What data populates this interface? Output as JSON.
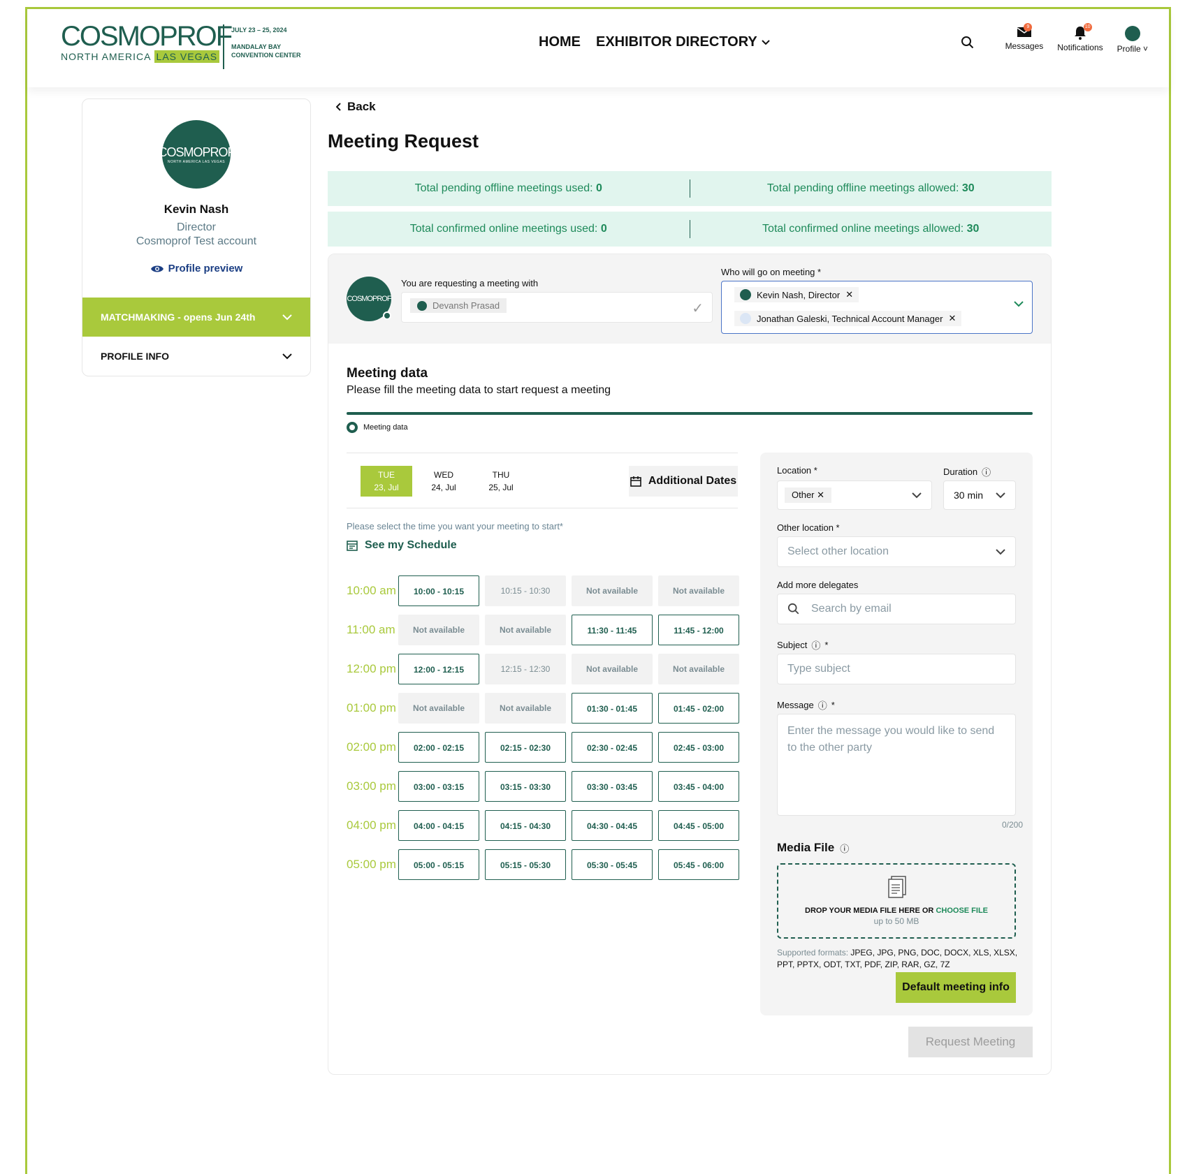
{
  "header": {
    "logo": {
      "main": "COSMOPROF",
      "sub_left": "NORTH AMERICA",
      "sub_right": "LAS VEGAS",
      "date": "JULY 23 – 25, 2024",
      "venue_1": "MANDALAY BAY",
      "venue_2": "CONVENTION CENTER"
    },
    "nav": [
      "HOME",
      "EXHIBITOR DIRECTORY"
    ],
    "icons": {
      "messages_label": "Messages",
      "messages_badge": "9",
      "notifications_label": "Notifications",
      "notifications_badge": "10",
      "profile_label": "Profile"
    }
  },
  "profile_card": {
    "avatar_text": "COSMOPROF",
    "avatar_sub": "NORTH AMERICA LAS VEGAS",
    "name": "Kevin Nash",
    "role": "Director",
    "company": "Cosmoprof Test account",
    "preview_label": "Profile preview",
    "matchmaking_label": "MATCHMAKING - opens Jun 24th",
    "profile_info_label": "PROFILE INFO"
  },
  "back_label": "Back",
  "page_title": "Meeting Request",
  "stats": {
    "pending_used_label": "Total pending offline meetings used:",
    "pending_used_value": "0",
    "pending_allowed_label": "Total pending offline meetings allowed:",
    "pending_allowed_value": "30",
    "confirmed_used_label": "Total confirmed online meetings used:",
    "confirmed_used_value": "0",
    "confirmed_allowed_label": "Total confirmed online meetings allowed:",
    "confirmed_allowed_value": "30"
  },
  "request": {
    "avatar_text": "COSMOPROF",
    "with_label": "You are requesting a meeting with",
    "with_value": "Devansh Prasad",
    "who_label": "Who will go on meeting *",
    "who": [
      "Kevin Nash, Director",
      "Jonathan Galeski, Technical Account Manager"
    ]
  },
  "meeting_data": {
    "title": "Meeting data",
    "subtitle": "Please fill the meeting data to start request a meeting",
    "step_label": "Meeting data"
  },
  "days": [
    {
      "dow": "TUE",
      "date": "23, Jul"
    },
    {
      "dow": "WED",
      "date": "24, Jul"
    },
    {
      "dow": "THU",
      "date": "25, Jul"
    }
  ],
  "additional_dates_label": "Additional Dates",
  "select_time_label": "Please select the time you want your meeting to start*",
  "see_schedule_label": "See my Schedule",
  "slots": [
    {
      "time": "10:00 am",
      "cells": [
        "10:00 - 10:15",
        "10:15 - 10:30",
        "Not available",
        "Not available"
      ],
      "kinds": [
        "av",
        "mut",
        "na",
        "na"
      ]
    },
    {
      "time": "11:00 am",
      "cells": [
        "Not available",
        "Not available",
        "11:30 - 11:45",
        "11:45 - 12:00"
      ],
      "kinds": [
        "na",
        "na",
        "av",
        "av"
      ]
    },
    {
      "time": "12:00 pm",
      "cells": [
        "12:00 - 12:15",
        "12:15 - 12:30",
        "Not available",
        "Not available"
      ],
      "kinds": [
        "av",
        "mut",
        "na",
        "na"
      ]
    },
    {
      "time": "01:00 pm",
      "cells": [
        "Not available",
        "Not available",
        "01:30 - 01:45",
        "01:45 - 02:00"
      ],
      "kinds": [
        "na",
        "na",
        "av",
        "av"
      ]
    },
    {
      "time": "02:00 pm",
      "cells": [
        "02:00 - 02:15",
        "02:15 - 02:30",
        "02:30 - 02:45",
        "02:45 - 03:00"
      ],
      "kinds": [
        "av",
        "av",
        "av",
        "av"
      ]
    },
    {
      "time": "03:00 pm",
      "cells": [
        "03:00 - 03:15",
        "03:15 - 03:30",
        "03:30 - 03:45",
        "03:45 - 04:00"
      ],
      "kinds": [
        "av",
        "av",
        "av",
        "av"
      ]
    },
    {
      "time": "04:00 pm",
      "cells": [
        "04:00 - 04:15",
        "04:15 - 04:30",
        "04:30 - 04:45",
        "04:45 - 05:00"
      ],
      "kinds": [
        "av",
        "av",
        "av",
        "av"
      ]
    },
    {
      "time": "05:00 pm",
      "cells": [
        "05:00 - 05:15",
        "05:15 - 05:30",
        "05:30 - 05:45",
        "05:45 - 06:00"
      ],
      "kinds": [
        "av",
        "av",
        "av",
        "av"
      ]
    }
  ],
  "form": {
    "location_label": "Location *",
    "location_value": "Other",
    "duration_label": "Duration",
    "duration_value": "30 min",
    "other_location_label": "Other location *",
    "other_location_placeholder": "Select other location",
    "delegates_label": "Add more delegates",
    "delegates_placeholder": "Search by email",
    "subject_label": "Subject",
    "subject_placeholder": "Type subject",
    "message_label": "Message",
    "message_placeholder": "Enter the message you would like to send to the other party",
    "counter": "0/200",
    "media_label": "Media File",
    "drop_text": "DROP YOUR MEDIA FILE HERE OR",
    "choose_file": "CHOOSE FILE",
    "size_limit": "up to 50 MB",
    "formats_label": "Supported formats:",
    "formats": "JPEG, JPG, PNG, DOC, DOCX, XLS, XLSX, PPT, PPTX, ODT, TXT, PDF, ZIP, RAR, GZ, 7Z",
    "default_button": "Default meeting info"
  },
  "request_button": "Request Meeting",
  "colors": {
    "brand_green": "#1f5e4f",
    "lime": "#a9c93c",
    "stat_bg": "#e1f5ee"
  }
}
